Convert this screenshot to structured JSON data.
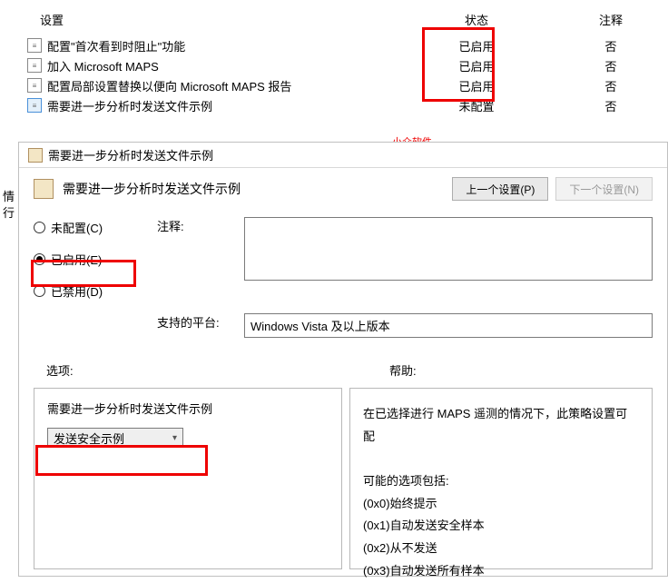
{
  "list": {
    "headers": {
      "setting": "设置",
      "state": "状态",
      "comment": "注释"
    },
    "rows": [
      {
        "name": "配置\"首次看到时阻止\"功能",
        "state": "已启用",
        "comment": "否"
      },
      {
        "name": "加入 Microsoft MAPS",
        "state": "已启用",
        "comment": "否"
      },
      {
        "name": "配置局部设置替换以便向 Microsoft MAPS 报告",
        "state": "已启用",
        "comment": "否"
      },
      {
        "name": "需要进一步分析时发送文件示例",
        "state": "未配置",
        "comment": "否"
      }
    ]
  },
  "sideText": {
    "l1": "情",
    "l2": "行"
  },
  "watermark": "小众软件",
  "dialog": {
    "title": "需要进一步分析时发送文件示例",
    "headerTitle": "需要进一步分析时发送文件示例",
    "prevBtn": "上一个设置(P)",
    "nextBtn": "下一个设置(N)",
    "radios": {
      "unconfigured": "未配置(C)",
      "enabled": "已启用(E)",
      "disabled": "已禁用(D)"
    },
    "commentLabel": "注释:",
    "platformLabel": "支持的平台:",
    "platformValue": "Windows Vista 及以上版本",
    "optionsLabel": "选项:",
    "helpLabel": "帮助:",
    "optPanelLabel": "需要进一步分析时发送文件示例",
    "selectValue": "发送安全示例",
    "help": {
      "intro": "在已选择进行 MAPS 遥测的情况下，此策略设置可配",
      "optsHeader": "可能的选项包括:",
      "o0": "(0x0)始终提示",
      "o1": "(0x1)自动发送安全样本",
      "o2": "(0x2)从不发送",
      "o3": "(0x3)自动发送所有样本"
    }
  }
}
